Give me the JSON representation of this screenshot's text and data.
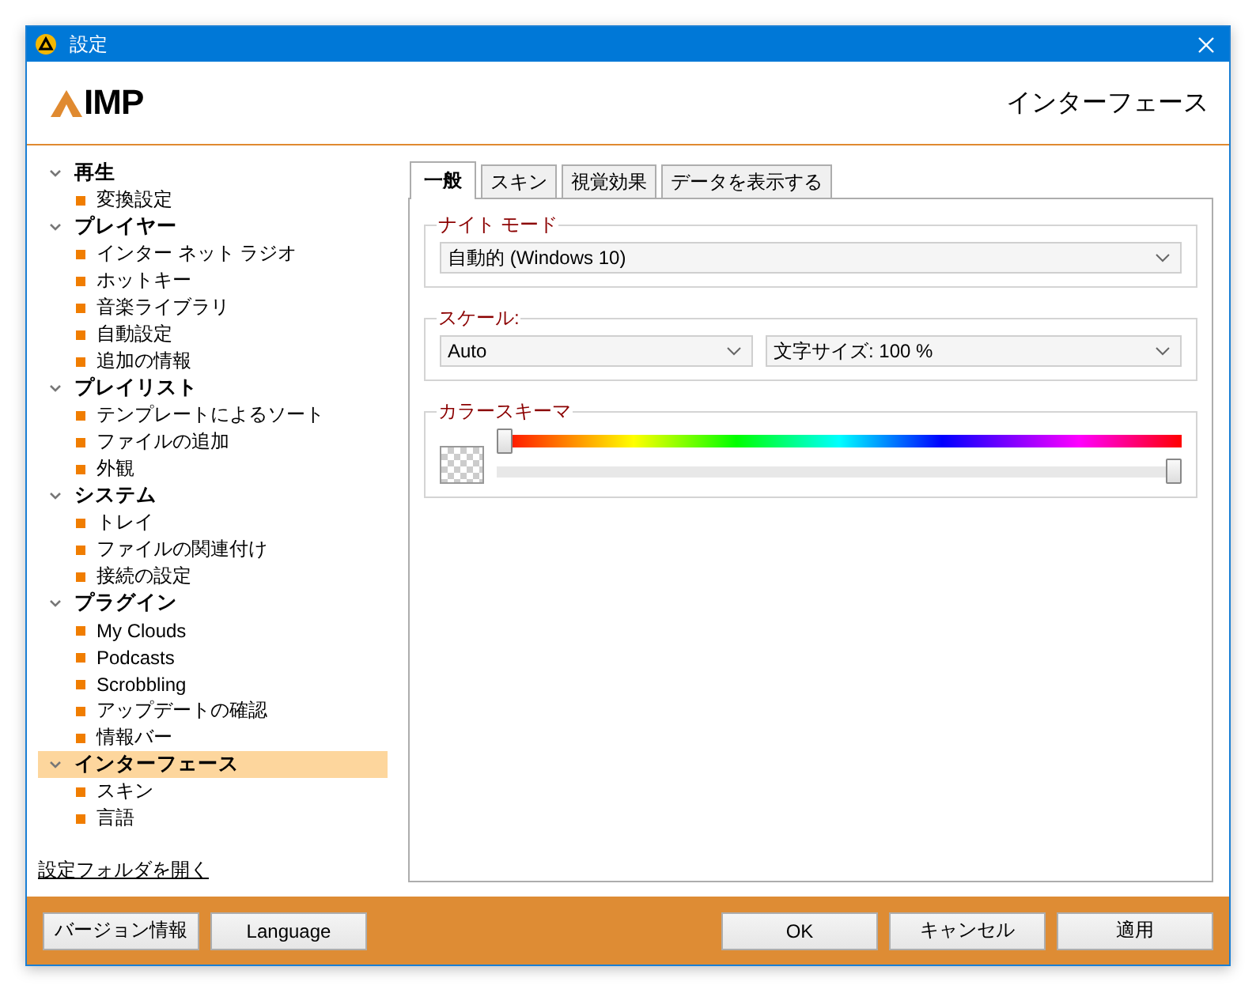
{
  "window": {
    "title": "設定"
  },
  "header": {
    "logo_text": "IMP",
    "section_title": "インターフェース"
  },
  "sidebar": {
    "items": [
      {
        "label": "再生",
        "expanded": true,
        "selected": false,
        "children": [
          {
            "label": "変換設定",
            "selected": false
          }
        ]
      },
      {
        "label": "プレイヤー",
        "expanded": true,
        "selected": false,
        "children": [
          {
            "label": "インター ネット ラジオ",
            "selected": false
          },
          {
            "label": "ホットキー",
            "selected": false
          },
          {
            "label": "音楽ライブラリ",
            "selected": false
          },
          {
            "label": "自動設定",
            "selected": false
          },
          {
            "label": "追加の情報",
            "selected": false
          }
        ]
      },
      {
        "label": "プレイリスト",
        "expanded": true,
        "selected": false,
        "children": [
          {
            "label": "テンプレートによるソート",
            "selected": false
          },
          {
            "label": "ファイルの追加",
            "selected": false
          },
          {
            "label": "外観",
            "selected": false
          }
        ]
      },
      {
        "label": "システム",
        "expanded": true,
        "selected": false,
        "children": [
          {
            "label": "トレイ",
            "selected": false
          },
          {
            "label": "ファイルの関連付け",
            "selected": false
          },
          {
            "label": "接続の設定",
            "selected": false
          }
        ]
      },
      {
        "label": "プラグイン",
        "expanded": true,
        "selected": false,
        "children": [
          {
            "label": "My Clouds",
            "selected": false
          },
          {
            "label": "Podcasts",
            "selected": false
          },
          {
            "label": "Scrobbling",
            "selected": false
          },
          {
            "label": "アップデートの確認",
            "selected": false
          },
          {
            "label": "情報バー",
            "selected": false
          }
        ]
      },
      {
        "label": "インターフェース",
        "expanded": true,
        "selected": true,
        "children": [
          {
            "label": "スキン",
            "selected": false
          },
          {
            "label": "言語",
            "selected": false
          }
        ]
      }
    ],
    "link": "設定フォルダを開く"
  },
  "tabs": [
    {
      "label": "一般",
      "selected": true
    },
    {
      "label": "スキン",
      "selected": false
    },
    {
      "label": "視覚効果",
      "selected": false
    },
    {
      "label": "データを表示する",
      "selected": false
    }
  ],
  "night_mode": {
    "legend": "ナイト モード",
    "value": "自動的 (Windows 10)"
  },
  "scale": {
    "legend": "スケール:",
    "value": "Auto",
    "font_size": "文字サイズ: 100 %"
  },
  "color_scheme": {
    "legend": "カラースキーマ",
    "hue": {
      "level": 0
    },
    "opacity": {
      "level": 1
    }
  },
  "footer": {
    "left_buttons": [
      "バージョン情報",
      "Language"
    ],
    "right_buttons": [
      "OK",
      "キャンセル",
      "適用"
    ]
  }
}
